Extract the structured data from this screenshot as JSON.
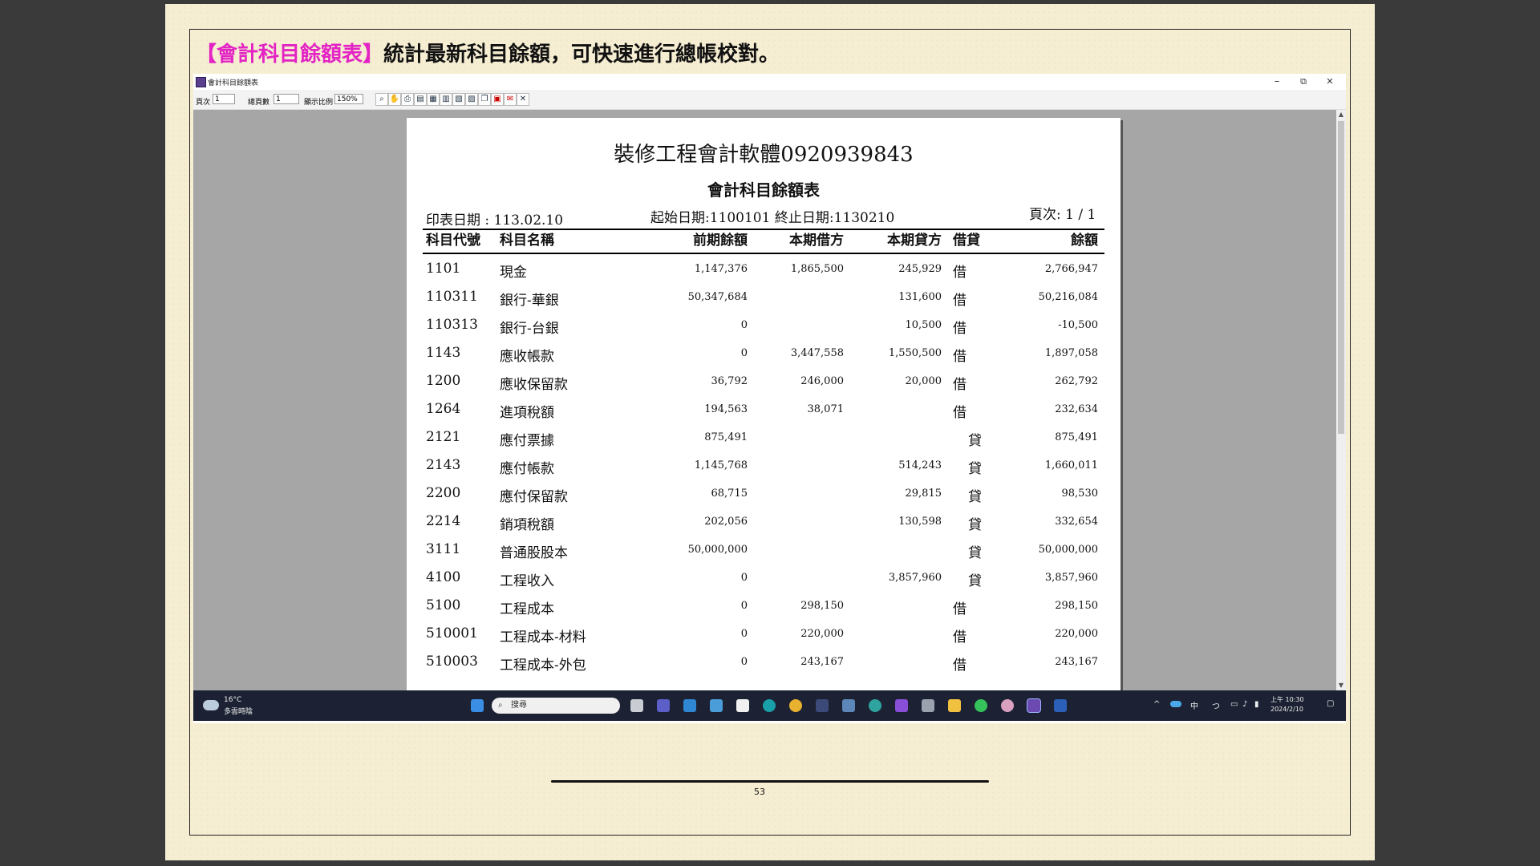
{
  "heading": {
    "highlight": "【會計科目餘額表】",
    "text": "統計最新科目餘額，可快速進行總帳校對。"
  },
  "window": {
    "title": "會計科目餘額表",
    "minimize": "–",
    "restore": "⧉",
    "close": "✕"
  },
  "toolbar": {
    "page_label": "頁次",
    "page_value": "1",
    "total_label": "總頁數",
    "total_value": "1",
    "zoom_label": "顯示比例",
    "zoom_value": "150%"
  },
  "report": {
    "company": "裝修工程會計軟體0920939843",
    "title": "會計科目餘額表",
    "print_date": "印表日期 : 113.02.10",
    "date_range": "起始日期:1100101 終止日期:1130210",
    "page": "頁次: 1 / 1",
    "columns": {
      "code": "科目代號",
      "name": "科目名稱",
      "prev": "前期餘額",
      "debit": "本期借方",
      "credit": "本期貸方",
      "dir": "借貸",
      "bal": "餘額"
    },
    "rows": [
      {
        "code": "1101",
        "name": "現金",
        "prev": "1,147,376",
        "debit": "1,865,500",
        "credit": "245,929",
        "dir": "借",
        "bal": "2,766,947"
      },
      {
        "code": "110311",
        "name": "銀行-華銀",
        "prev": "50,347,684",
        "debit": "",
        "credit": "131,600",
        "dir": "借",
        "bal": "50,216,084"
      },
      {
        "code": "110313",
        "name": "銀行-台銀",
        "prev": "0",
        "debit": "",
        "credit": "10,500",
        "dir": "借",
        "bal": "-10,500"
      },
      {
        "code": "1143",
        "name": "應收帳款",
        "prev": "0",
        "debit": "3,447,558",
        "credit": "1,550,500",
        "dir": "借",
        "bal": "1,897,058"
      },
      {
        "code": "1200",
        "name": "應收保留款",
        "prev": "36,792",
        "debit": "246,000",
        "credit": "20,000",
        "dir": "借",
        "bal": "262,792"
      },
      {
        "code": "1264",
        "name": "進項稅額",
        "prev": "194,563",
        "debit": "38,071",
        "credit": "",
        "dir": "借",
        "bal": "232,634"
      },
      {
        "code": "2121",
        "name": "應付票據",
        "prev": "875,491",
        "debit": "",
        "credit": "",
        "dir": "貸",
        "bal": "875,491"
      },
      {
        "code": "2143",
        "name": "應付帳款",
        "prev": "1,145,768",
        "debit": "",
        "credit": "514,243",
        "dir": "貸",
        "bal": "1,660,011"
      },
      {
        "code": "2200",
        "name": "應付保留款",
        "prev": "68,715",
        "debit": "",
        "credit": "29,815",
        "dir": "貸",
        "bal": "98,530"
      },
      {
        "code": "2214",
        "name": "銷項稅額",
        "prev": "202,056",
        "debit": "",
        "credit": "130,598",
        "dir": "貸",
        "bal": "332,654"
      },
      {
        "code": "3111",
        "name": "普通股股本",
        "prev": "50,000,000",
        "debit": "",
        "credit": "",
        "dir": "貸",
        "bal": "50,000,000"
      },
      {
        "code": "4100",
        "name": "工程收入",
        "prev": "0",
        "debit": "",
        "credit": "3,857,960",
        "dir": "貸",
        "bal": "3,857,960"
      },
      {
        "code": "5100",
        "name": "工程成本",
        "prev": "0",
        "debit": "298,150",
        "credit": "",
        "dir": "借",
        "bal": "298,150"
      },
      {
        "code": "510001",
        "name": "工程成本-材料",
        "prev": "0",
        "debit": "220,000",
        "credit": "",
        "dir": "借",
        "bal": "220,000"
      },
      {
        "code": "510003",
        "name": "工程成本-外包",
        "prev": "0",
        "debit": "243,167",
        "credit": "",
        "dir": "借",
        "bal": "243,167"
      }
    ]
  },
  "taskbar": {
    "weather_temp": "16°C",
    "weather_desc": "多雲時陰",
    "search_placeholder": "搜尋",
    "ime": "中",
    "time": "上午 10:30",
    "date": "2024/2/10"
  },
  "page_number": "53"
}
